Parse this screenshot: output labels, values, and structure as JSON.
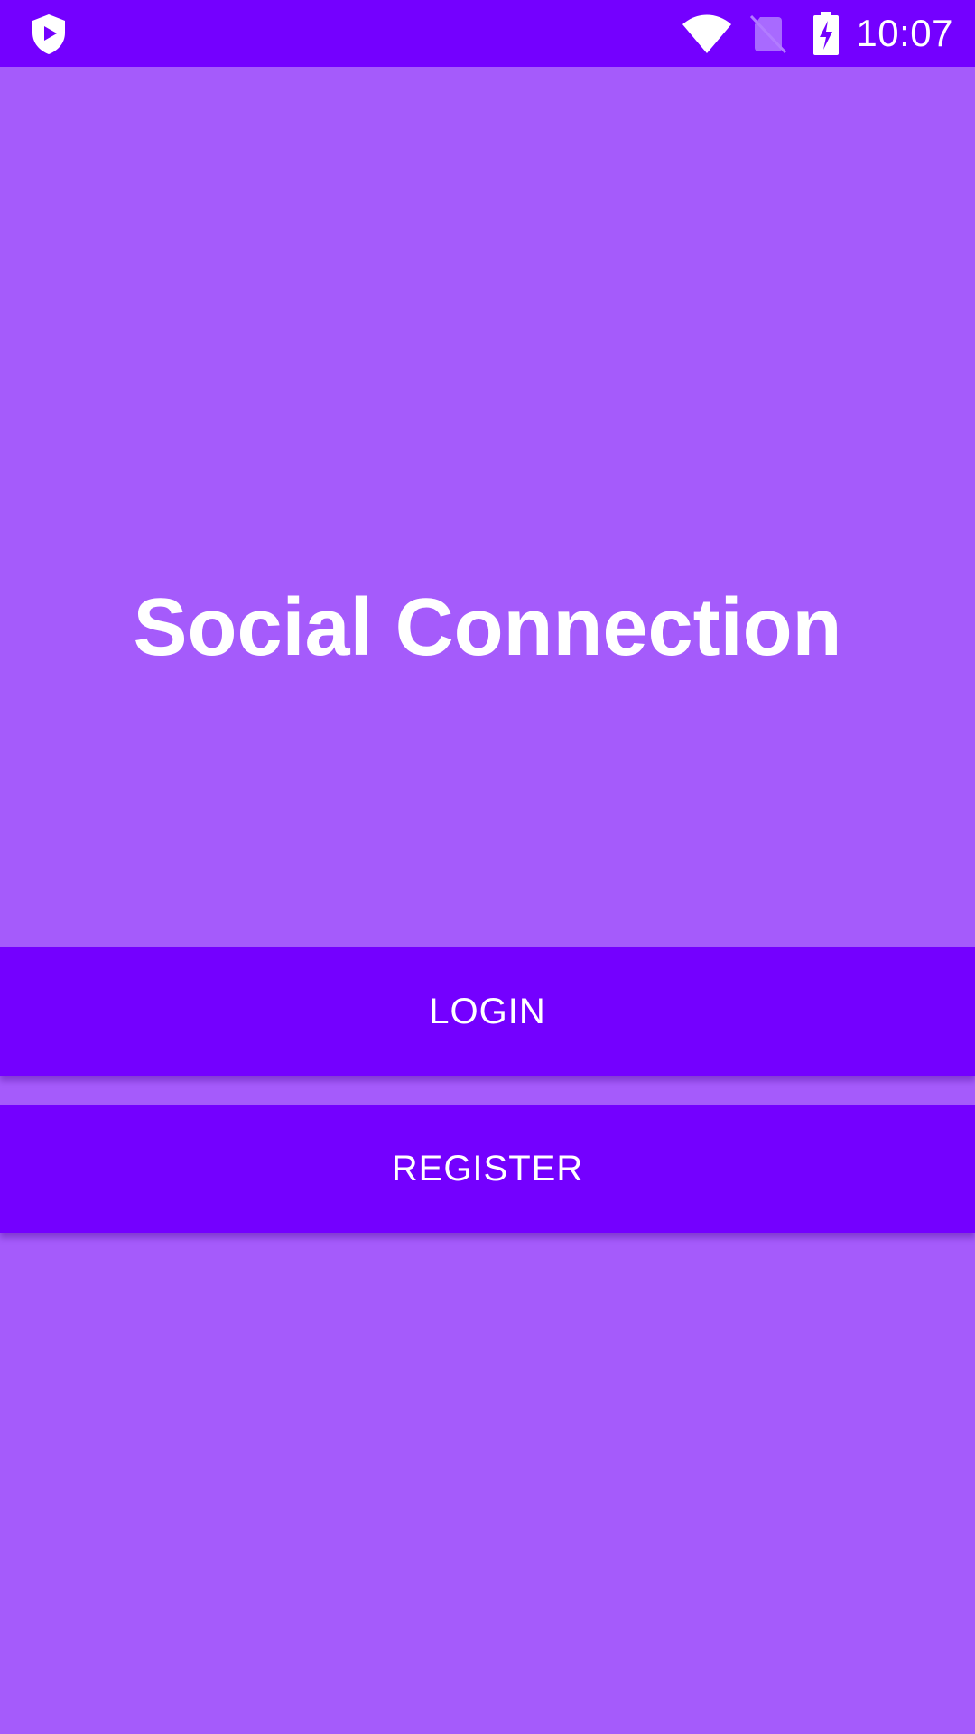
{
  "status_bar": {
    "time": "10:07",
    "left_icon": "shield-play-icon",
    "icons": [
      "wifi-icon",
      "no-sim-icon",
      "battery-charging-icon"
    ],
    "background": "#7400FF"
  },
  "main": {
    "title": "Social Connection",
    "background": "#A55BFB",
    "buttons": {
      "login_label": "LOGIN",
      "register_label": "REGISTER"
    },
    "accent": "#7400FF"
  }
}
